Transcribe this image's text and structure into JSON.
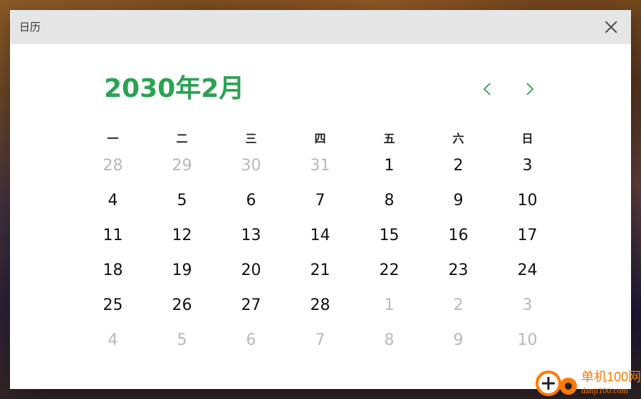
{
  "window": {
    "title": "日历",
    "close_icon": "close-icon"
  },
  "calendar": {
    "month_label": "2030年2月",
    "prev_icon": "chevron-left-icon",
    "next_icon": "chevron-right-icon",
    "accent_color": "#2aa252",
    "weekdays": [
      "一",
      "二",
      "三",
      "四",
      "五",
      "六",
      "日"
    ],
    "days": [
      {
        "label": "28",
        "muted": true
      },
      {
        "label": "29",
        "muted": true
      },
      {
        "label": "30",
        "muted": true
      },
      {
        "label": "31",
        "muted": true
      },
      {
        "label": "1",
        "muted": false
      },
      {
        "label": "2",
        "muted": false
      },
      {
        "label": "3",
        "muted": false
      },
      {
        "label": "4",
        "muted": false
      },
      {
        "label": "5",
        "muted": false
      },
      {
        "label": "6",
        "muted": false
      },
      {
        "label": "7",
        "muted": false
      },
      {
        "label": "8",
        "muted": false
      },
      {
        "label": "9",
        "muted": false
      },
      {
        "label": "10",
        "muted": false
      },
      {
        "label": "11",
        "muted": false
      },
      {
        "label": "12",
        "muted": false
      },
      {
        "label": "13",
        "muted": false
      },
      {
        "label": "14",
        "muted": false
      },
      {
        "label": "15",
        "muted": false
      },
      {
        "label": "16",
        "muted": false
      },
      {
        "label": "17",
        "muted": false
      },
      {
        "label": "18",
        "muted": false
      },
      {
        "label": "19",
        "muted": false
      },
      {
        "label": "20",
        "muted": false
      },
      {
        "label": "21",
        "muted": false
      },
      {
        "label": "22",
        "muted": false
      },
      {
        "label": "23",
        "muted": false
      },
      {
        "label": "24",
        "muted": false
      },
      {
        "label": "25",
        "muted": false
      },
      {
        "label": "26",
        "muted": false
      },
      {
        "label": "27",
        "muted": false
      },
      {
        "label": "28",
        "muted": false
      },
      {
        "label": "1",
        "muted": true
      },
      {
        "label": "2",
        "muted": true
      },
      {
        "label": "3",
        "muted": true
      },
      {
        "label": "4",
        "muted": true
      },
      {
        "label": "5",
        "muted": true
      },
      {
        "label": "6",
        "muted": true
      },
      {
        "label": "7",
        "muted": true
      },
      {
        "label": "8",
        "muted": true
      },
      {
        "label": "9",
        "muted": true
      },
      {
        "label": "10",
        "muted": true
      }
    ]
  },
  "watermark": {
    "brand_cn": "单机100网",
    "domain": "danji100.com",
    "color": "#ff7a00"
  }
}
